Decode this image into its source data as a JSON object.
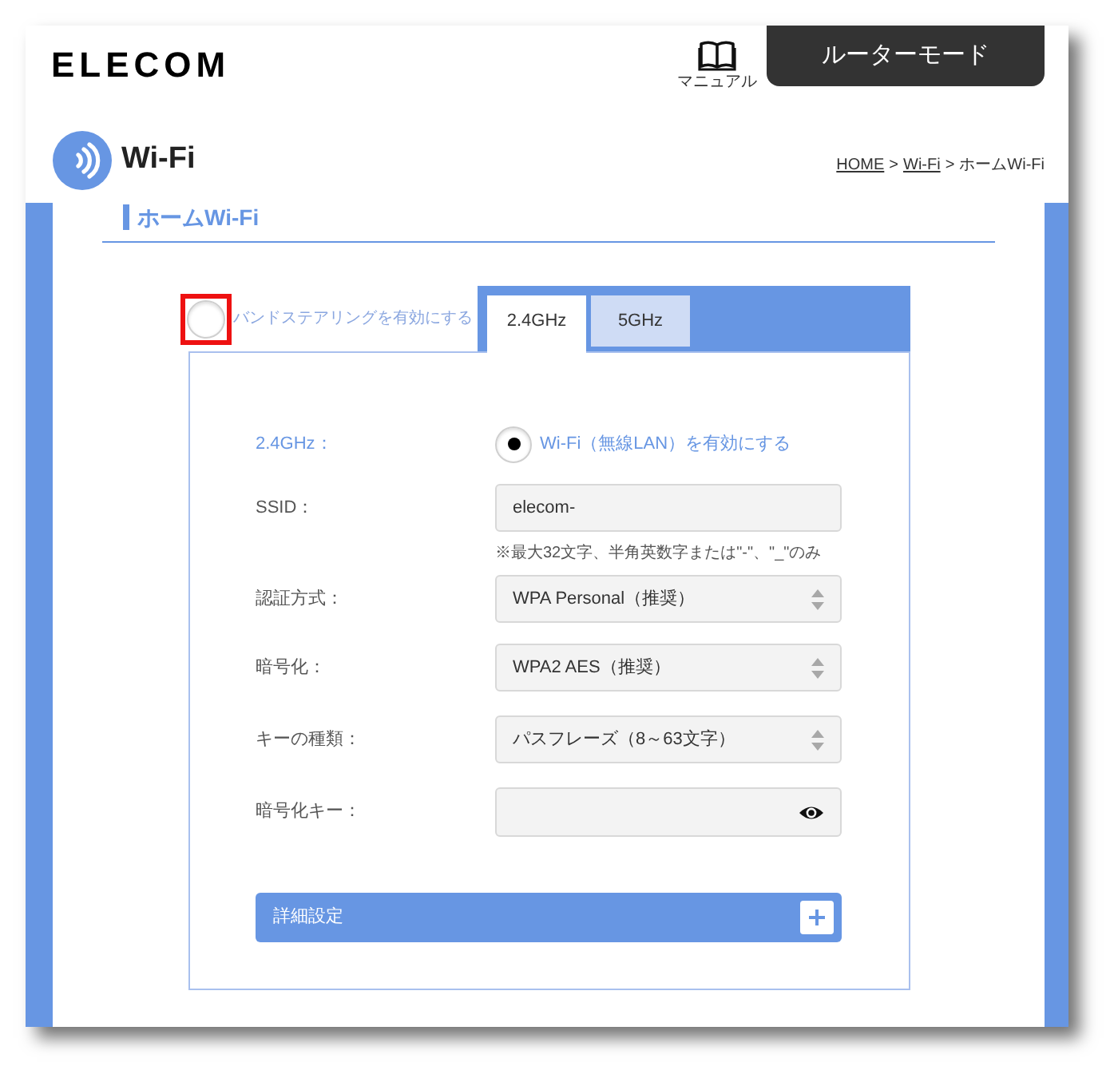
{
  "header": {
    "logo": "ELECOM",
    "manual_link": "マニュアル",
    "mode_button": "ルーターモード"
  },
  "page_title": "Wi-Fi",
  "breadcrumb": [
    {
      "kind": "link",
      "text": "HOME"
    },
    {
      "kind": "separator",
      "text": ">"
    },
    {
      "kind": "link",
      "text": "Wi-Fi"
    },
    {
      "kind": "separator",
      "text": ">"
    },
    {
      "kind": "current",
      "text": "ホームWi-Fi"
    }
  ],
  "section_title": "ホームWi-Fi",
  "band_steering": {
    "label": "バンドステアリングを有効にする",
    "checked": false,
    "highlighted": true
  },
  "tabs": [
    {
      "label": "2.4GHz",
      "selected": true
    },
    {
      "label": "5GHz",
      "selected": false
    }
  ],
  "form": {
    "rows": [
      {
        "kind": "radio",
        "label": "2.4GHz：",
        "option": "Wi-Fi（無線LAN）を有効にする",
        "checked": true
      },
      {
        "kind": "text",
        "label": "SSID：",
        "value": "elecom-",
        "hint": "※最大32文字、半角英数字または\"-\"、\"_\"のみ"
      },
      {
        "kind": "select",
        "label": "認証方式：",
        "value": "WPA Personal（推奨）"
      },
      {
        "kind": "select",
        "label": "暗号化：",
        "value": "WPA2 AES（推奨）"
      },
      {
        "kind": "select",
        "label": "キーの種類：",
        "value": "パスフレーズ（8～63文字）"
      },
      {
        "kind": "password",
        "label": "暗号化キー："
      }
    ]
  },
  "advanced": {
    "label": "詳細設定",
    "expanded": false
  }
}
